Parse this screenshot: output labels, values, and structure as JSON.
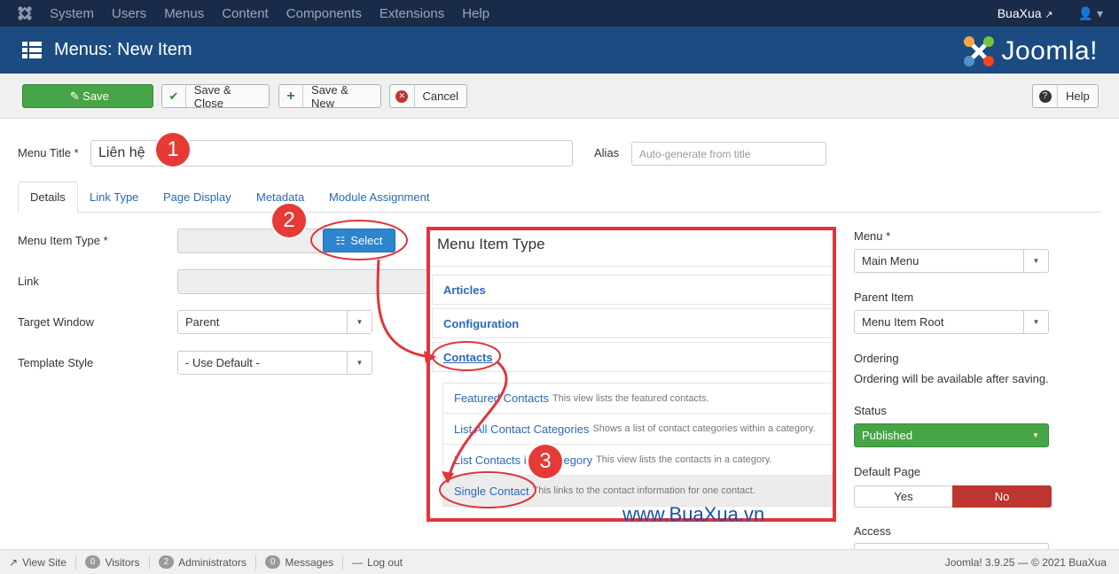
{
  "topnav": {
    "items": [
      "System",
      "Users",
      "Menus",
      "Content",
      "Components",
      "Extensions",
      "Help"
    ],
    "user": "BuaXua"
  },
  "header": {
    "title": "Menus: New Item",
    "brand": "Joomla!"
  },
  "toolbar": {
    "save": "Save",
    "save_close": "Save & Close",
    "save_new": "Save & New",
    "cancel": "Cancel",
    "help": "Help"
  },
  "form": {
    "menu_title_label": "Menu Title *",
    "menu_title_value": "Liên hệ",
    "alias_label": "Alias",
    "alias_placeholder": "Auto-generate from title",
    "tabs": [
      "Details",
      "Link Type",
      "Page Display",
      "Metadata",
      "Module Assignment"
    ],
    "menu_item_type_label": "Menu Item Type *",
    "select_button": "Select",
    "link_label": "Link",
    "target_window_label": "Target Window",
    "target_window_value": "Parent",
    "template_style_label": "Template Style",
    "template_style_value": "- Use Default -"
  },
  "modal": {
    "title": "Menu Item Type",
    "groups": [
      "Articles",
      "Configuration",
      "Contacts"
    ],
    "items": [
      {
        "name": "Featured Contacts",
        "desc": "This view lists the featured contacts."
      },
      {
        "name": "List All Contact Categories",
        "desc": "Shows a list of contact categories within a category."
      },
      {
        "name": "List Contacts in a Category",
        "desc": "This view lists the contacts in a category."
      },
      {
        "name": "Single Contact",
        "desc": "This links to the contact information for one contact."
      }
    ]
  },
  "sidebar": {
    "menu_label": "Menu *",
    "menu_value": "Main Menu",
    "parent_label": "Parent Item",
    "parent_value": "Menu Item Root",
    "ordering_label": "Ordering",
    "ordering_text": "Ordering will be available after saving.",
    "status_label": "Status",
    "status_value": "Published",
    "default_page_label": "Default Page",
    "yes": "Yes",
    "no": "No",
    "access_label": "Access"
  },
  "footer": {
    "view_site": "View Site",
    "visitors_count": "0",
    "visitors": "Visitors",
    "admins_count": "2",
    "admins": "Administrators",
    "messages_count": "0",
    "messages": "Messages",
    "logout": "Log out",
    "version": "Joomla! 3.9.25 — © 2021 BuaXua"
  },
  "annotations": {
    "n1": "1",
    "n2": "2",
    "n3": "3"
  },
  "watermark": "www.BuaXua.vn",
  "colors": {
    "nav": "#1a2b4a",
    "header": "#1b4b80",
    "save": "#46a546",
    "status": "#46a546",
    "no": "#bd362f",
    "highlight": "#e0353a"
  }
}
